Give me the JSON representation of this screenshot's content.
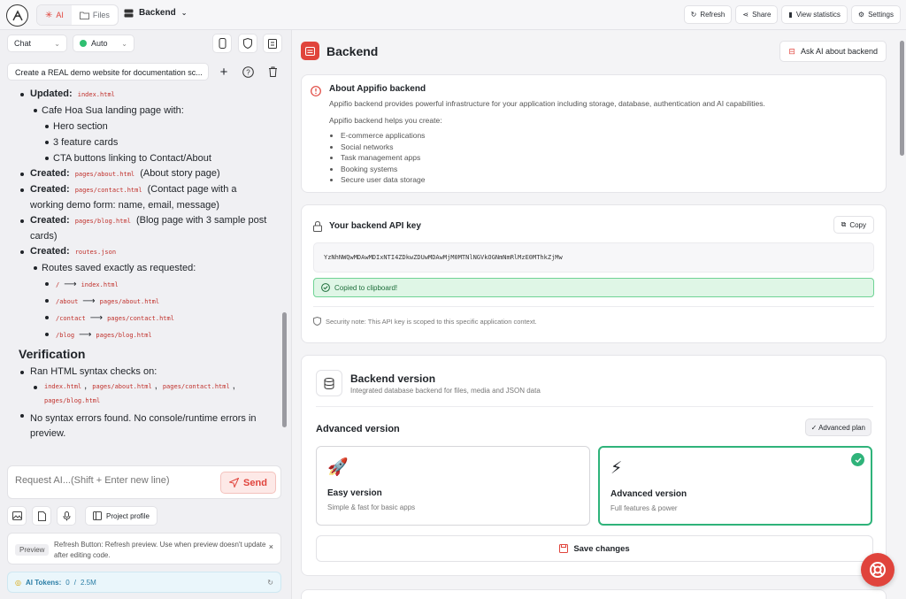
{
  "topbar": {
    "tabs": [
      {
        "label": "AI",
        "active": true
      },
      {
        "label": "Files",
        "active": false
      }
    ],
    "project_name": "Backend",
    "actions": [
      "Refresh",
      "Share",
      "View statistics",
      "Settings"
    ]
  },
  "left": {
    "mode_select": "Chat",
    "model_select": "Auto",
    "conversation_title": "Create a REAL demo website for documentation sc...",
    "chat": {
      "updated_label": "Updated:",
      "updated_file": "index.html",
      "landing": "Cafe Hoa Sua landing page with:",
      "landing_items": [
        "Hero section",
        "3 feature cards",
        "CTA buttons linking to Contact/About"
      ],
      "created": [
        {
          "label": "Created:",
          "file": "pages/about.html",
          "desc": "(About story page)"
        },
        {
          "label": "Created:",
          "file": "pages/contact.html",
          "desc": "(Contact page with a working demo form: name, email, message)"
        },
        {
          "label": "Created:",
          "file": "pages/blog.html",
          "desc": "(Blog page with 3 sample post cards)"
        },
        {
          "label": "Created:",
          "file": "routes.json",
          "desc": ""
        }
      ],
      "routes_saved": "Routes saved exactly as requested:",
      "routes": [
        {
          "from": "/",
          "to": "index.html"
        },
        {
          "from": "/about",
          "to": "pages/about.html"
        },
        {
          "from": "/contact",
          "to": "pages/contact.html"
        },
        {
          "from": "/blog",
          "to": "pages/blog.html"
        }
      ],
      "arrow": "⟶",
      "verification_heading": "Verification",
      "ran_checks": "Ran HTML syntax checks on:",
      "checked_files": [
        "index.html",
        "pages/about.html",
        "pages/contact.html",
        "pages/blog.html"
      ],
      "no_errors": "No syntax errors found. No console/runtime errors in preview."
    },
    "input_placeholder": "Request AI...(Shift + Enter new line)",
    "send_label": "Send",
    "project_profile_label": "Project profile",
    "tip": {
      "badge": "Preview",
      "text": "Refresh Button: Refresh preview. Use when preview doesn't update after editing code.",
      "close": "×"
    },
    "tokens": {
      "label": "AI Tokens:",
      "used": "0",
      "sep": "/",
      "total": "2.5M"
    }
  },
  "right": {
    "page_title": "Backend",
    "ask_ai_label": "Ask AI about backend",
    "about": {
      "title": "About Appifio backend",
      "description": "Appifio backend provides powerful infrastructure for your application including storage, database, authentication and AI capabilities.",
      "helps_label": "Appifio backend helps you create:",
      "items": [
        "E-commerce applications",
        "Social networks",
        "Task management apps",
        "Booking systems",
        "Secure user data storage"
      ]
    },
    "api_key": {
      "title": "Your backend API key",
      "copy_label": "Copy",
      "key": "YzNhNWQwMDAwMDIxNTI4ZDkwZDUwMDAwMjM0MTNlNGVkOGNmNmRlMzE0MThkZjMw",
      "copied_label": "Copied to clipboard!",
      "security_note": "Security note: This API key is scoped to this specific application context."
    },
    "version": {
      "title": "Backend version",
      "subtitle": "Integrated database backend for files, media and JSON data",
      "current_label": "Advanced version",
      "plan_badge": "✓ Advanced plan",
      "options": [
        {
          "icon": "🚀",
          "title": "Easy version",
          "subtitle": "Simple & fast for basic apps",
          "selected": false
        },
        {
          "icon": "⚡",
          "title": "Advanced version",
          "subtitle": "Full features & power",
          "selected": true
        }
      ],
      "save_label": "Save changes"
    }
  },
  "colors": {
    "accent": "#e0443c",
    "success": "#2fb37a",
    "success_bg": "#dff6e6"
  }
}
